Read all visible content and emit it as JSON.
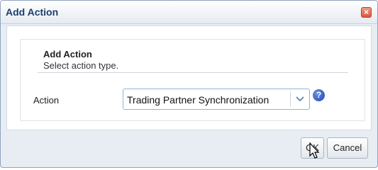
{
  "dialog": {
    "title": "Add Action",
    "close_icon": "close-icon"
  },
  "panel": {
    "title": "Add Action",
    "subtitle": "Select action type."
  },
  "form": {
    "action_label": "Action",
    "action_value": "Trading Partner Synchronization",
    "help_icon": "help-icon"
  },
  "footer": {
    "ok_label": "OK",
    "cancel_label": "Cancel"
  },
  "colors": {
    "title_text": "#1c3e6b",
    "close_button": "#d9553b",
    "help_icon": "#1f47b5",
    "select_border": "#8fb3d9"
  }
}
